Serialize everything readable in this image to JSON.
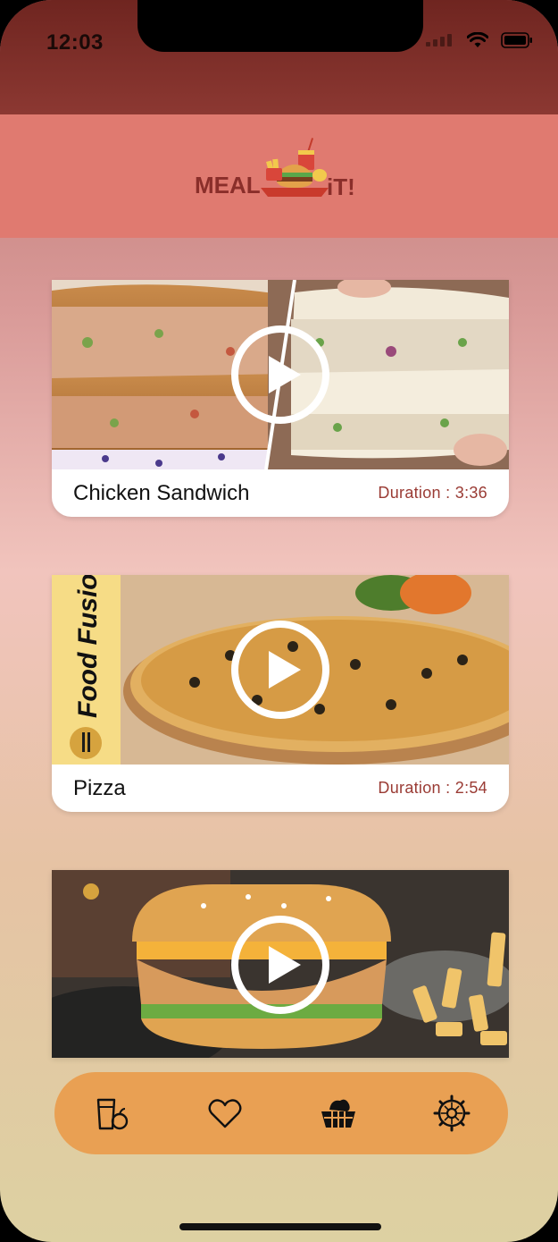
{
  "status": {
    "time": "12:03"
  },
  "header": {
    "logo_text": "MEAL IT!"
  },
  "videos": [
    {
      "title": "Chicken Sandwich",
      "duration": "Duration : 3:36"
    },
    {
      "title": "Pizza",
      "duration": "Duration : 2:54"
    },
    {
      "title": "",
      "duration": ""
    }
  ],
  "thumb_texts": {
    "brand": "Food Fusion"
  },
  "nav": {
    "items": [
      {
        "icon": "drink-fruit-icon"
      },
      {
        "icon": "heart-icon"
      },
      {
        "icon": "food-basket-icon"
      },
      {
        "icon": "gear-icon"
      }
    ]
  }
}
